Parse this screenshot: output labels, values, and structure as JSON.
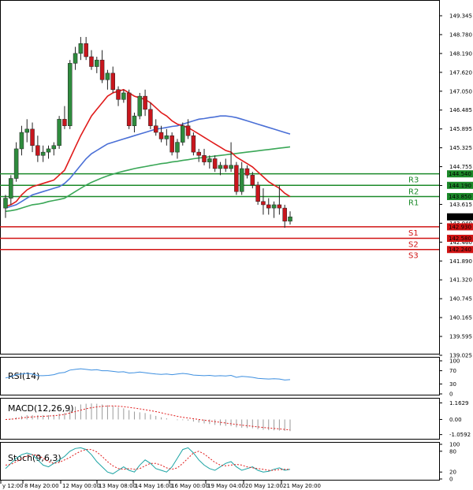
{
  "colors": {
    "bull": "#2e8b3d",
    "bear": "#c8161d",
    "ema_red": "#e01b1b",
    "ema_blue": "#4a6fd6",
    "ema_green": "#3aa757",
    "resistance": "#1c8a2a",
    "support": "#d11414",
    "price_box": "#000000",
    "rsi": "#3d8fe0",
    "stoch_main": "#1aa3a3",
    "stoch_signal": "#e01b1b"
  },
  "chart_data": [
    {
      "type": "candlestick",
      "panel": "price",
      "y_ticks": [
        "149.345",
        "148.780",
        "148.190",
        "147.620",
        "147.050",
        "146.485",
        "145.895",
        "145.325",
        "144.755",
        "144.185",
        "143.615",
        "143.040",
        "142.460",
        "141.890",
        "141.320",
        "140.745",
        "140.165",
        "139.595",
        "139.025"
      ],
      "ylim": [
        139.025,
        149.345
      ],
      "x_ticks": [
        "y 12:00",
        "8 May 20:00",
        "12 May 00:00",
        "13 May 08:00",
        "14 May 16:00",
        "16 May 00:00",
        "19 May 04:00",
        "20 May 12:00",
        "21 May 20:00"
      ],
      "candles": [
        {
          "o": 143.5,
          "h": 143.9,
          "l": 143.2,
          "c": 143.8
        },
        {
          "o": 143.8,
          "h": 144.5,
          "l": 143.6,
          "c": 144.4
        },
        {
          "o": 144.4,
          "h": 145.5,
          "l": 144.3,
          "c": 145.3
        },
        {
          "o": 145.3,
          "h": 146.0,
          "l": 145.1,
          "c": 145.8
        },
        {
          "o": 145.8,
          "h": 146.2,
          "l": 145.5,
          "c": 145.9
        },
        {
          "o": 145.9,
          "h": 146.1,
          "l": 145.2,
          "c": 145.4
        },
        {
          "o": 145.4,
          "h": 145.7,
          "l": 144.9,
          "c": 145.1
        },
        {
          "o": 145.1,
          "h": 145.4,
          "l": 144.9,
          "c": 145.2
        },
        {
          "o": 145.2,
          "h": 145.4,
          "l": 145.0,
          "c": 145.3
        },
        {
          "o": 145.3,
          "h": 145.5,
          "l": 145.1,
          "c": 145.4
        },
        {
          "o": 145.4,
          "h": 146.3,
          "l": 145.3,
          "c": 146.2
        },
        {
          "o": 146.2,
          "h": 146.6,
          "l": 145.9,
          "c": 146.0
        },
        {
          "o": 146.0,
          "h": 148.0,
          "l": 145.9,
          "c": 147.9
        },
        {
          "o": 147.9,
          "h": 148.4,
          "l": 147.7,
          "c": 148.2
        },
        {
          "o": 148.2,
          "h": 148.7,
          "l": 148.0,
          "c": 148.5
        },
        {
          "o": 148.5,
          "h": 148.7,
          "l": 148.0,
          "c": 148.1
        },
        {
          "o": 148.1,
          "h": 148.3,
          "l": 147.7,
          "c": 147.8
        },
        {
          "o": 147.8,
          "h": 148.1,
          "l": 147.6,
          "c": 148.0
        },
        {
          "o": 148.0,
          "h": 148.3,
          "l": 147.3,
          "c": 147.4
        },
        {
          "o": 147.4,
          "h": 147.7,
          "l": 147.1,
          "c": 147.6
        },
        {
          "o": 147.6,
          "h": 147.8,
          "l": 147.0,
          "c": 147.1
        },
        {
          "o": 147.1,
          "h": 147.2,
          "l": 146.6,
          "c": 146.8
        },
        {
          "o": 146.8,
          "h": 147.1,
          "l": 146.7,
          "c": 147.0
        },
        {
          "o": 147.0,
          "h": 147.1,
          "l": 145.9,
          "c": 146.0
        },
        {
          "o": 146.0,
          "h": 146.4,
          "l": 145.8,
          "c": 146.3
        },
        {
          "o": 146.3,
          "h": 147.0,
          "l": 146.2,
          "c": 146.9
        },
        {
          "o": 146.9,
          "h": 147.1,
          "l": 146.3,
          "c": 146.5
        },
        {
          "o": 146.5,
          "h": 146.7,
          "l": 145.9,
          "c": 146.0
        },
        {
          "o": 146.0,
          "h": 146.2,
          "l": 145.7,
          "c": 145.8
        },
        {
          "o": 145.8,
          "h": 146.0,
          "l": 145.5,
          "c": 145.6
        },
        {
          "o": 145.6,
          "h": 145.9,
          "l": 145.4,
          "c": 145.7
        },
        {
          "o": 145.7,
          "h": 145.8,
          "l": 145.1,
          "c": 145.2
        },
        {
          "o": 145.2,
          "h": 145.6,
          "l": 145.0,
          "c": 145.5
        },
        {
          "o": 145.5,
          "h": 146.1,
          "l": 145.4,
          "c": 146.0
        },
        {
          "o": 146.0,
          "h": 146.2,
          "l": 145.6,
          "c": 145.7
        },
        {
          "o": 145.7,
          "h": 145.8,
          "l": 145.1,
          "c": 145.2
        },
        {
          "o": 145.2,
          "h": 145.3,
          "l": 144.9,
          "c": 145.1
        },
        {
          "o": 145.1,
          "h": 145.3,
          "l": 144.8,
          "c": 144.9
        },
        {
          "o": 144.9,
          "h": 145.1,
          "l": 144.7,
          "c": 145.0
        },
        {
          "o": 145.0,
          "h": 145.1,
          "l": 144.6,
          "c": 144.7
        },
        {
          "o": 144.7,
          "h": 144.9,
          "l": 144.5,
          "c": 144.8
        },
        {
          "o": 144.8,
          "h": 145.0,
          "l": 144.6,
          "c": 144.7
        },
        {
          "o": 144.7,
          "h": 145.5,
          "l": 144.6,
          "c": 144.8
        },
        {
          "o": 144.8,
          "h": 144.9,
          "l": 143.9,
          "c": 144.0
        },
        {
          "o": 144.0,
          "h": 144.9,
          "l": 143.9,
          "c": 144.7
        },
        {
          "o": 144.7,
          "h": 144.8,
          "l": 144.4,
          "c": 144.5
        },
        {
          "o": 144.5,
          "h": 144.6,
          "l": 144.1,
          "c": 144.2
        },
        {
          "o": 144.2,
          "h": 144.3,
          "l": 143.6,
          "c": 143.7
        },
        {
          "o": 143.7,
          "h": 144.1,
          "l": 143.3,
          "c": 143.6
        },
        {
          "o": 143.6,
          "h": 143.8,
          "l": 143.3,
          "c": 143.5
        },
        {
          "o": 143.5,
          "h": 143.7,
          "l": 143.2,
          "c": 143.6
        },
        {
          "o": 143.6,
          "h": 144.2,
          "l": 143.3,
          "c": 143.5
        },
        {
          "o": 143.5,
          "h": 143.6,
          "l": 142.9,
          "c": 143.1
        },
        {
          "o": 143.1,
          "h": 143.4,
          "l": 143.0,
          "c": 143.233
        }
      ],
      "ema_red": [
        143.55,
        143.6,
        143.7,
        143.9,
        144.05,
        144.15,
        144.2,
        144.25,
        144.3,
        144.35,
        144.5,
        144.65,
        145.0,
        145.35,
        145.7,
        146.0,
        146.3,
        146.5,
        146.7,
        146.9,
        147.0,
        147.05,
        147.1,
        147.0,
        146.9,
        146.85,
        146.8,
        146.7,
        146.55,
        146.4,
        146.3,
        146.15,
        146.05,
        146.0,
        145.95,
        145.85,
        145.75,
        145.65,
        145.55,
        145.45,
        145.35,
        145.25,
        145.2,
        145.05,
        144.95,
        144.85,
        144.75,
        144.6,
        144.45,
        144.3,
        144.2,
        144.1,
        143.95,
        143.85
      ],
      "ema_blue": [
        143.5,
        143.55,
        143.6,
        143.7,
        143.8,
        143.9,
        143.95,
        144.0,
        144.05,
        144.1,
        144.15,
        144.25,
        144.4,
        144.6,
        144.8,
        145.0,
        145.15,
        145.25,
        145.35,
        145.45,
        145.5,
        145.55,
        145.6,
        145.65,
        145.7,
        145.75,
        145.8,
        145.85,
        145.9,
        145.92,
        145.95,
        145.98,
        146.0,
        146.05,
        146.1,
        146.15,
        146.2,
        146.22,
        146.25,
        146.27,
        146.3,
        146.3,
        146.28,
        146.25,
        146.2,
        146.15,
        146.1,
        146.05,
        146.0,
        145.95,
        145.9,
        145.85,
        145.8,
        145.75
      ],
      "ema_green": [
        143.4,
        143.42,
        143.45,
        143.5,
        143.55,
        143.6,
        143.62,
        143.65,
        143.7,
        143.73,
        143.76,
        143.8,
        143.9,
        144.0,
        144.1,
        144.2,
        144.28,
        144.35,
        144.42,
        144.48,
        144.53,
        144.58,
        144.62,
        144.66,
        144.7,
        144.73,
        144.76,
        144.79,
        144.82,
        144.85,
        144.87,
        144.9,
        144.92,
        144.95,
        144.97,
        145.0,
        145.02,
        145.04,
        145.06,
        145.08,
        145.1,
        145.12,
        145.14,
        145.16,
        145.18,
        145.2,
        145.22,
        145.24,
        145.26,
        145.28,
        145.3,
        145.32,
        145.34,
        145.36
      ],
      "levels": [
        {
          "label": "R3",
          "value": 144.54,
          "price": "144.540",
          "kind": "resistance"
        },
        {
          "label": "R2",
          "value": 144.19,
          "price": "144.190",
          "kind": "resistance"
        },
        {
          "label": "R1",
          "value": 143.85,
          "price": "143.850",
          "kind": "resistance"
        },
        {
          "label": "S1",
          "value": 142.93,
          "price": "142.930",
          "kind": "support"
        },
        {
          "label": "S2",
          "value": 142.58,
          "price": "142.580",
          "kind": "support"
        },
        {
          "label": "S3",
          "value": 142.24,
          "price": "142.240",
          "kind": "support"
        }
      ],
      "current_price": {
        "value": 143.233,
        "price": "143.233"
      }
    },
    {
      "type": "line",
      "panel": "rsi",
      "title": "RSI(14)",
      "ylim": [
        0,
        100
      ],
      "y_ticks": [
        "100",
        "70",
        "30",
        "0"
      ],
      "values": [
        48,
        52,
        58,
        60,
        62,
        60,
        55,
        55,
        56,
        58,
        63,
        65,
        72,
        74,
        76,
        74,
        72,
        73,
        70,
        70,
        68,
        66,
        67,
        63,
        64,
        66,
        64,
        62,
        60,
        59,
        60,
        58,
        60,
        62,
        60,
        57,
        56,
        55,
        56,
        54,
        55,
        54,
        56,
        50,
        53,
        52,
        50,
        47,
        46,
        45,
        46,
        45,
        42,
        43
      ]
    },
    {
      "type": "bar",
      "panel": "macd",
      "title": "MACD(12,26,9)",
      "ylim": [
        -1.3,
        1.35
      ],
      "y_ticks": [
        "1.1629",
        "0.00",
        "-1.0592"
      ],
      "histogram": [
        0.0,
        0.05,
        0.15,
        0.25,
        0.3,
        0.3,
        0.3,
        0.3,
        0.3,
        0.32,
        0.4,
        0.45,
        0.7,
        0.9,
        1.05,
        1.1,
        1.12,
        1.1,
        1.05,
        1.0,
        0.95,
        0.85,
        0.78,
        0.65,
        0.55,
        0.5,
        0.45,
        0.35,
        0.25,
        0.15,
        0.08,
        0.0,
        -0.05,
        -0.05,
        -0.08,
        -0.15,
        -0.22,
        -0.28,
        -0.32,
        -0.38,
        -0.42,
        -0.45,
        -0.46,
        -0.55,
        -0.58,
        -0.6,
        -0.62,
        -0.68,
        -0.72,
        -0.75,
        -0.76,
        -0.78,
        -0.8,
        -0.82
      ],
      "signal": [
        0.0,
        0.02,
        0.05,
        0.1,
        0.15,
        0.18,
        0.2,
        0.22,
        0.24,
        0.26,
        0.3,
        0.35,
        0.45,
        0.55,
        0.65,
        0.75,
        0.82,
        0.88,
        0.92,
        0.94,
        0.95,
        0.93,
        0.9,
        0.85,
        0.8,
        0.74,
        0.68,
        0.62,
        0.55,
        0.47,
        0.38,
        0.3,
        0.22,
        0.15,
        0.1,
        0.05,
        0.0,
        -0.05,
        -0.1,
        -0.15,
        -0.2,
        -0.25,
        -0.3,
        -0.35,
        -0.4,
        -0.44,
        -0.48,
        -0.52,
        -0.56,
        -0.6,
        -0.63,
        -0.66,
        -0.7,
        -0.73
      ]
    },
    {
      "type": "line",
      "panel": "stoch",
      "title": "Stoch(9,6,3)",
      "ylim": [
        0,
        100
      ],
      "y_ticks": [
        "100",
        "80",
        "20",
        "0"
      ],
      "main": [
        30,
        45,
        60,
        70,
        75,
        70,
        55,
        40,
        35,
        45,
        55,
        65,
        80,
        88,
        90,
        85,
        70,
        50,
        35,
        20,
        15,
        25,
        35,
        25,
        20,
        40,
        55,
        45,
        30,
        25,
        20,
        35,
        60,
        85,
        90,
        75,
        55,
        40,
        30,
        25,
        35,
        45,
        50,
        35,
        25,
        30,
        35,
        25,
        20,
        22,
        28,
        32,
        25,
        28
      ],
      "signal": [
        40,
        42,
        50,
        58,
        66,
        70,
        68,
        60,
        50,
        45,
        48,
        55,
        62,
        72,
        80,
        85,
        85,
        78,
        65,
        50,
        38,
        30,
        28,
        30,
        28,
        30,
        38,
        45,
        45,
        40,
        32,
        28,
        32,
        45,
        60,
        75,
        80,
        72,
        60,
        48,
        40,
        38,
        40,
        42,
        40,
        35,
        32,
        30,
        28,
        25,
        25,
        27,
        28,
        28
      ]
    }
  ]
}
